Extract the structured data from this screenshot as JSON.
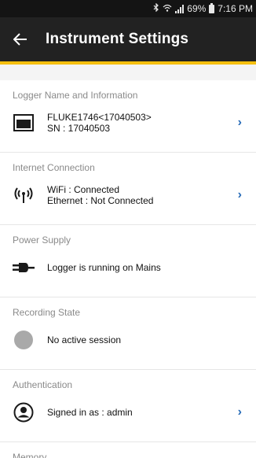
{
  "status_bar": {
    "battery": "69%",
    "time": "7:16 PM",
    "bluetooth_icon": "bluetooth-icon",
    "wifi_icon": "wifi-icon",
    "signal_icon": "signal-icon"
  },
  "app_bar": {
    "title": "Instrument Settings",
    "back_icon": "arrow-left-icon"
  },
  "colors": {
    "app_bar": "#222222",
    "accent": "#f5bf0f",
    "chevron": "#2a6db8",
    "header_text": "#8a8a8a",
    "idle_circle": "#a9a9a9"
  },
  "sections": {
    "logger": {
      "header": "Logger Name and Information",
      "line1": "FLUKE1746<17040503>",
      "line2": "SN : 17040503",
      "icon": "device-icon",
      "chevron": "›"
    },
    "internet": {
      "header": "Internet Connection",
      "line1": "WiFi : Connected",
      "line2": "Ethernet : Not Connected",
      "icon": "antenna-icon",
      "chevron": "›"
    },
    "power": {
      "header": "Power Supply",
      "line1": "Logger is running on Mains",
      "icon": "power-plug-icon"
    },
    "recording": {
      "header": "Recording State",
      "line1": "No active session",
      "icon": "idle-circle-icon"
    },
    "authentication": {
      "header": "Authentication",
      "line1": "Signed in as : admin",
      "icon": "user-icon",
      "chevron": "›"
    },
    "memory": {
      "header": "Memory"
    }
  }
}
